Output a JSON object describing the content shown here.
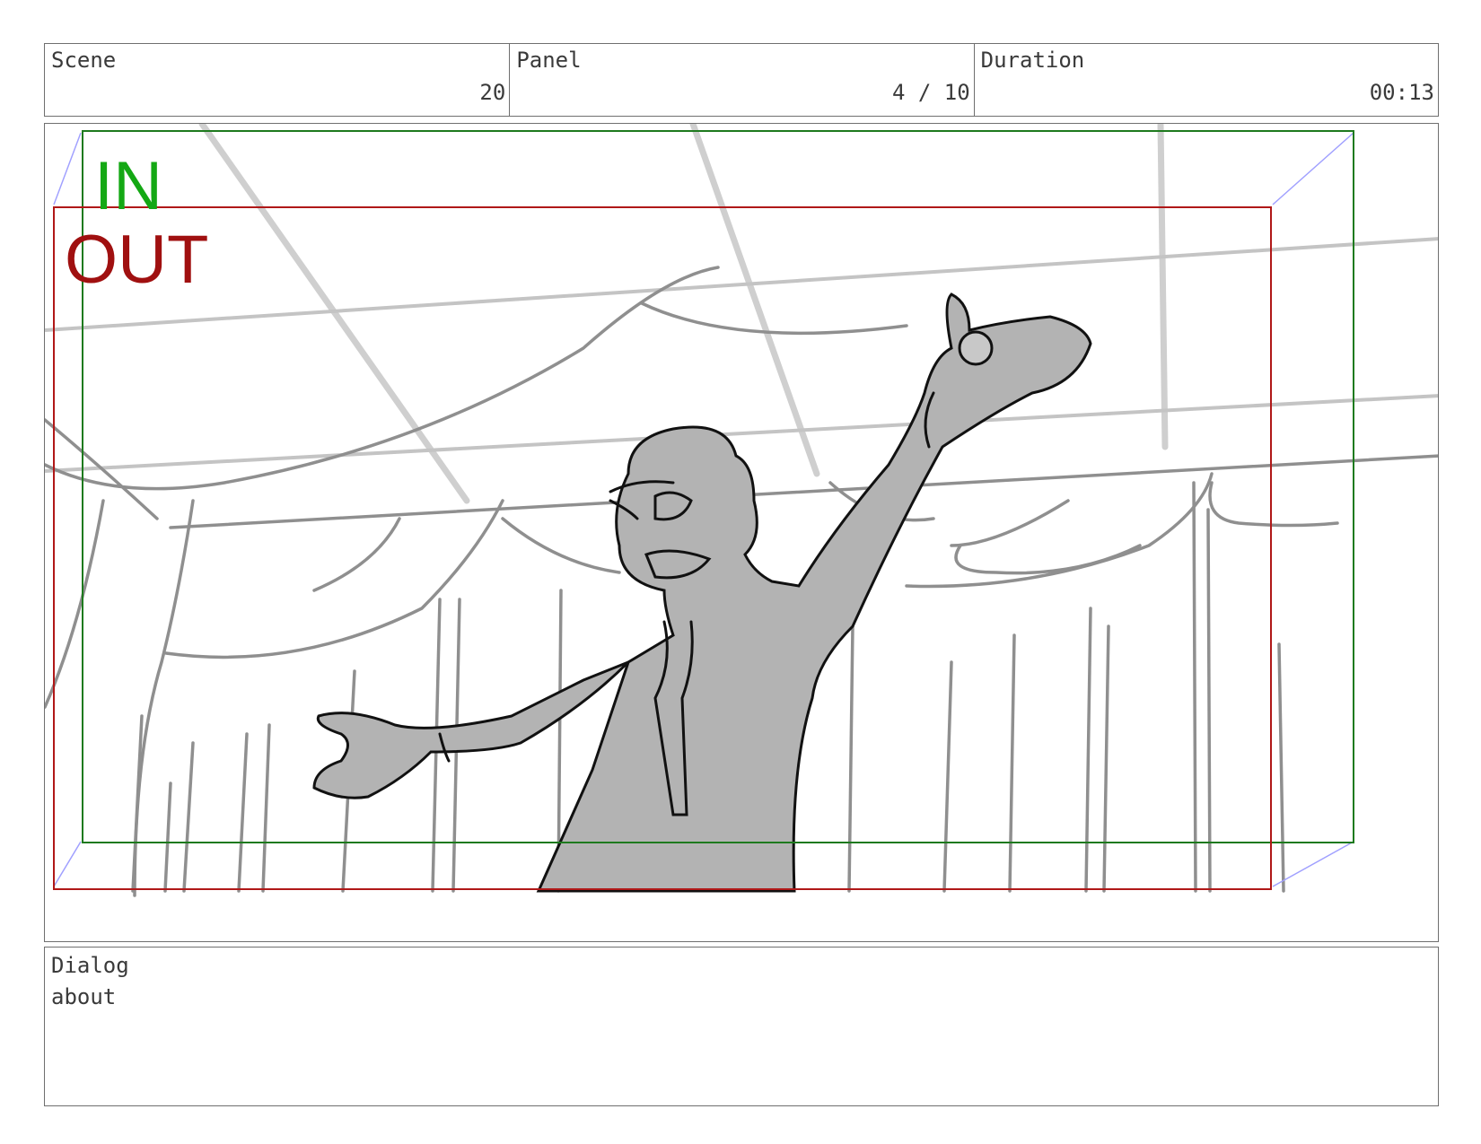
{
  "header": {
    "scene": {
      "label": "Scene",
      "value": "20"
    },
    "panel": {
      "label": "Panel",
      "value": "4 / 10"
    },
    "duration": {
      "label": "Duration",
      "value": "00:13"
    }
  },
  "frame": {
    "in_label": "IN",
    "out_label": "OUT",
    "colors": {
      "in_frame": "#1e7a1e",
      "out_frame": "#b01818",
      "arrows": "#a0a0ff",
      "sketch_fill": "#b3b3b3"
    }
  },
  "dialog": {
    "label": "Dialog",
    "text": "about"
  }
}
